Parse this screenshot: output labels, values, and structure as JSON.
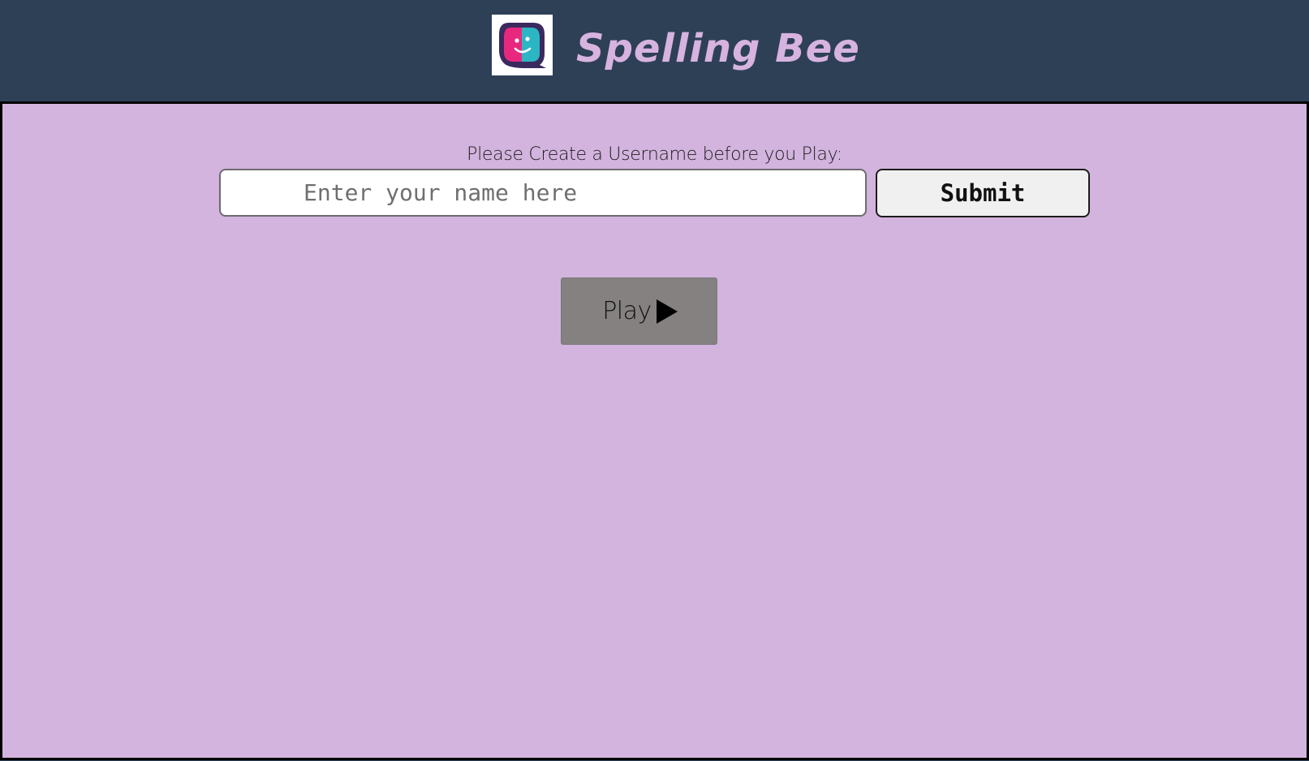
{
  "header": {
    "title": "Spelling Bee",
    "logo_icon": "smiley-chat-bubble-icon",
    "background_color": "#2e4056",
    "title_color": "#d7b3e0"
  },
  "main": {
    "background_color": "#d3b4de",
    "prompt_label": "Please Create a Username before you Play:",
    "username_input": {
      "value": "",
      "placeholder": "Enter your name here"
    },
    "submit_label": "Submit",
    "play_button": {
      "label": "Play",
      "icon": "play-triangle-icon",
      "background_color": "#858181"
    }
  }
}
